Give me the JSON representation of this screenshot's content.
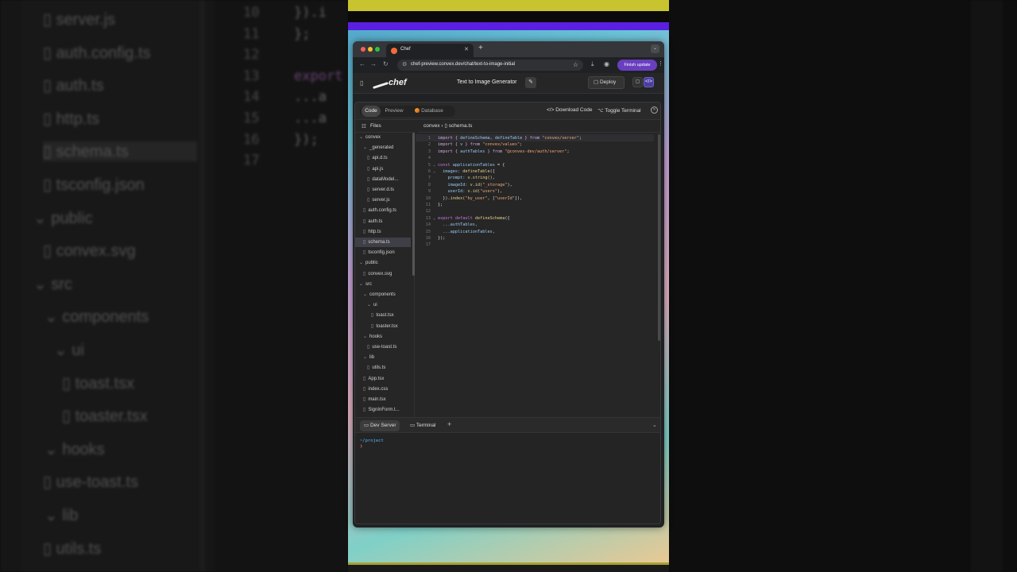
{
  "background": {
    "left_files": [
      {
        "label": "server.js",
        "sel": false
      },
      {
        "label": "auth.config.ts",
        "sel": false
      },
      {
        "label": "auth.ts",
        "sel": false
      },
      {
        "label": "http.ts",
        "sel": false
      },
      {
        "label": "schema.ts",
        "sel": true
      },
      {
        "label": "tsconfig.json",
        "sel": false
      },
      {
        "label": "public",
        "sel": false
      },
      {
        "label": "convex.svg",
        "sel": false
      },
      {
        "label": "src",
        "sel": false
      },
      {
        "label": "components",
        "sel": false
      },
      {
        "label": "ui",
        "sel": false
      },
      {
        "label": "toast.tsx",
        "sel": false
      },
      {
        "label": "toaster.tsx",
        "sel": false
      },
      {
        "label": "hooks",
        "sel": false
      },
      {
        "label": "use-toast.ts",
        "sel": false
      },
      {
        "label": "lib",
        "sel": false
      },
      {
        "label": "utils.ts",
        "sel": false
      }
    ],
    "line_numbers": [
      "10",
      "11",
      "12",
      "13",
      "14",
      "15",
      "16",
      "17"
    ],
    "code_fragments": [
      "}).i",
      "};",
      "",
      "export",
      "...a",
      "...a",
      "});",
      ""
    ]
  },
  "browser": {
    "tab_title": "Chef",
    "url": "chef-preview.convex.dev/chat/text-to-image-initial",
    "finish_update_label": "Finish update"
  },
  "app": {
    "logo_text": "chef",
    "project_title": "Text to Image Generator",
    "deploy_label": "Deploy"
  },
  "workbench": {
    "tabs": [
      {
        "label": "Code",
        "active": true
      },
      {
        "label": "Preview",
        "active": false
      },
      {
        "label": "Database",
        "active": false
      }
    ],
    "download_label": "Download Code",
    "toggle_terminal_label": "Toggle Terminal",
    "files_label": "Files",
    "breadcrumb": {
      "folder": "convex",
      "file": "schema.ts"
    },
    "file_tree": [
      {
        "label": "convex",
        "kind": "folder",
        "depth": 0,
        "sel": false
      },
      {
        "label": "_generated",
        "kind": "folder",
        "depth": 1,
        "sel": false
      },
      {
        "label": "api.d.ts",
        "kind": "file",
        "depth": 2,
        "sel": false
      },
      {
        "label": "api.js",
        "kind": "file",
        "depth": 2,
        "sel": false
      },
      {
        "label": "dataModel...",
        "kind": "file",
        "depth": 2,
        "sel": false
      },
      {
        "label": "server.d.ts",
        "kind": "file",
        "depth": 2,
        "sel": false
      },
      {
        "label": "server.js",
        "kind": "file",
        "depth": 2,
        "sel": false
      },
      {
        "label": "auth.config.ts",
        "kind": "file",
        "depth": 1,
        "sel": false
      },
      {
        "label": "auth.ts",
        "kind": "file",
        "depth": 1,
        "sel": false
      },
      {
        "label": "http.ts",
        "kind": "file",
        "depth": 1,
        "sel": false
      },
      {
        "label": "schema.ts",
        "kind": "file",
        "depth": 1,
        "sel": true
      },
      {
        "label": "tsconfig.json",
        "kind": "file",
        "depth": 1,
        "sel": false
      },
      {
        "label": "public",
        "kind": "folder",
        "depth": 0,
        "sel": false
      },
      {
        "label": "convex.svg",
        "kind": "file",
        "depth": 1,
        "sel": false
      },
      {
        "label": "src",
        "kind": "folder",
        "depth": 0,
        "sel": false
      },
      {
        "label": "components",
        "kind": "folder",
        "depth": 1,
        "sel": false
      },
      {
        "label": "ui",
        "kind": "folder",
        "depth": 2,
        "sel": false
      },
      {
        "label": "toast.tsx",
        "kind": "file",
        "depth": 3,
        "sel": false
      },
      {
        "label": "toaster.tsx",
        "kind": "file",
        "depth": 3,
        "sel": false
      },
      {
        "label": "hooks",
        "kind": "folder",
        "depth": 1,
        "sel": false
      },
      {
        "label": "use-toast.ts",
        "kind": "file",
        "depth": 2,
        "sel": false
      },
      {
        "label": "lib",
        "kind": "folder",
        "depth": 1,
        "sel": false
      },
      {
        "label": "utils.ts",
        "kind": "file",
        "depth": 2,
        "sel": false
      },
      {
        "label": "App.tsx",
        "kind": "file",
        "depth": 1,
        "sel": false
      },
      {
        "label": "index.css",
        "kind": "file",
        "depth": 1,
        "sel": false
      },
      {
        "label": "main.tsx",
        "kind": "file",
        "depth": 1,
        "sel": false
      },
      {
        "label": "SignInForm.t...",
        "kind": "file",
        "depth": 1,
        "sel": false
      }
    ],
    "code_lines": [
      {
        "n": "1",
        "fold": "",
        "tokens": [
          [
            "import { ",
            "#d8a8e8"
          ],
          [
            "defineSchema, defineTable",
            "#9ac8f0"
          ],
          [
            " } from ",
            "#d8a8e8"
          ],
          [
            "\"convex/server\"",
            "#f0a878"
          ],
          [
            ";",
            "#ddd"
          ]
        ]
      },
      {
        "n": "2",
        "fold": "",
        "tokens": [
          [
            "import { ",
            "#d8a8e8"
          ],
          [
            "v",
            "#9ac8f0"
          ],
          [
            " } from ",
            "#d8a8e8"
          ],
          [
            "\"convex/values\"",
            "#f0a878"
          ],
          [
            ";",
            "#ddd"
          ]
        ]
      },
      {
        "n": "3",
        "fold": "",
        "tokens": [
          [
            "import { ",
            "#d8a8e8"
          ],
          [
            "authTables",
            "#9ac8f0"
          ],
          [
            " } from ",
            "#d8a8e8"
          ],
          [
            "\"@convex-dev/auth/server\"",
            "#f0a878"
          ],
          [
            ";",
            "#ddd"
          ]
        ]
      },
      {
        "n": "4",
        "fold": "",
        "tokens": []
      },
      {
        "n": "5",
        "fold": "⌄",
        "tokens": [
          [
            "const ",
            "#c678dd"
          ],
          [
            "applicationTables",
            "#9ac8f0"
          ],
          [
            " = {",
            "#ddd"
          ]
        ]
      },
      {
        "n": "6",
        "fold": "⌄",
        "tokens": [
          [
            "  images: ",
            "#9ac8f0"
          ],
          [
            "defineTable",
            "#e5d28c"
          ],
          [
            "({",
            "#ddd"
          ]
        ]
      },
      {
        "n": "7",
        "fold": "",
        "tokens": [
          [
            "    prompt: ",
            "#9ac8f0"
          ],
          [
            "v.string()",
            "#e5d28c"
          ],
          [
            ",",
            "#ddd"
          ]
        ]
      },
      {
        "n": "8",
        "fold": "",
        "tokens": [
          [
            "    imageId: ",
            "#9ac8f0"
          ],
          [
            "v.id(",
            "#e5d28c"
          ],
          [
            "\"_storage\"",
            "#f0a878"
          ],
          [
            "),",
            "#ddd"
          ]
        ]
      },
      {
        "n": "9",
        "fold": "",
        "tokens": [
          [
            "    userId: ",
            "#9ac8f0"
          ],
          [
            "v.id(",
            "#e5d28c"
          ],
          [
            "\"users\"",
            "#f0a878"
          ],
          [
            "),",
            "#ddd"
          ]
        ]
      },
      {
        "n": "10",
        "fold": "",
        "tokens": [
          [
            "  }).",
            "#ddd"
          ],
          [
            "index(",
            "#e5d28c"
          ],
          [
            "\"by_user\"",
            "#f0a878"
          ],
          [
            ", [",
            "#ddd"
          ],
          [
            "\"userId\"",
            "#f0a878"
          ],
          [
            "]),",
            "#ddd"
          ]
        ]
      },
      {
        "n": "11",
        "fold": "",
        "tokens": [
          [
            "};",
            "#ddd"
          ]
        ]
      },
      {
        "n": "12",
        "fold": "",
        "tokens": []
      },
      {
        "n": "13",
        "fold": "⌄",
        "tokens": [
          [
            "export default ",
            "#c678dd"
          ],
          [
            "defineSchema",
            "#e5d28c"
          ],
          [
            "({",
            "#ddd"
          ]
        ]
      },
      {
        "n": "14",
        "fold": "",
        "tokens": [
          [
            "  ...authTables,",
            "#9ac8f0"
          ]
        ]
      },
      {
        "n": "15",
        "fold": "",
        "tokens": [
          [
            "  ...applicationTables,",
            "#9ac8f0"
          ]
        ]
      },
      {
        "n": "16",
        "fold": "",
        "tokens": [
          [
            "});",
            "#ddd"
          ]
        ]
      },
      {
        "n": "17",
        "fold": "",
        "tokens": []
      }
    ],
    "bottom_tabs": [
      {
        "label": "Dev Server",
        "active": true
      },
      {
        "label": "Terminal",
        "active": false
      }
    ],
    "terminal_path": "~/project",
    "terminal_prompt": "❯"
  },
  "colors": {
    "accent_purple": "#6a3fbf",
    "terminal_path": "#56b6f7",
    "terminal_prompt": "#e06c75"
  }
}
